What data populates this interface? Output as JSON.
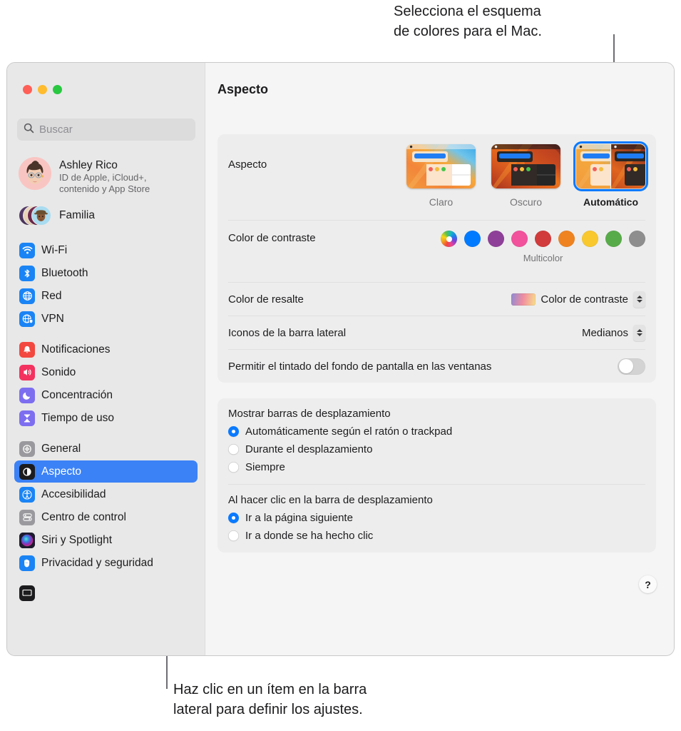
{
  "callouts": {
    "top": "Selecciona el esquema\nde colores para el Mac.",
    "bottom": "Haz clic en un ítem en la barra\nlateral para definir los ajustes."
  },
  "window": {
    "traffic_lights": [
      "close",
      "minimize",
      "zoom"
    ],
    "accent_color": "#3b82f6"
  },
  "search": {
    "placeholder": "Buscar",
    "value": "",
    "icon": "search-icon"
  },
  "sidebar": {
    "account": {
      "name": "Ashley Rico",
      "subtitle": "ID de Apple, iCloud+,\ncontenido y App Store"
    },
    "family": {
      "label": "Familia"
    },
    "groups": [
      {
        "items": [
          {
            "label": "Wi-Fi",
            "icon": "wifi-icon",
            "color": "#1a84f5",
            "selected": false
          },
          {
            "label": "Bluetooth",
            "icon": "bluetooth-icon",
            "color": "#1a84f5",
            "selected": false
          },
          {
            "label": "Red",
            "icon": "network-globe-icon",
            "color": "#1a84f5",
            "selected": false
          },
          {
            "label": "VPN",
            "icon": "vpn-globe-icon",
            "color": "#1a84f5",
            "selected": false
          }
        ]
      },
      {
        "items": [
          {
            "label": "Notificaciones",
            "icon": "bell-icon",
            "color": "#f2483f",
            "selected": false
          },
          {
            "label": "Sonido",
            "icon": "speaker-icon",
            "color": "#f3325f",
            "selected": false
          },
          {
            "label": "Concentración",
            "icon": "moon-icon",
            "color": "#7d6ef0",
            "selected": false
          },
          {
            "label": "Tiempo de uso",
            "icon": "hourglass-icon",
            "color": "#7d6ef0",
            "selected": false
          }
        ]
      },
      {
        "items": [
          {
            "label": "General",
            "icon": "gear-icon",
            "color": "#8e8e93",
            "selected": false
          },
          {
            "label": "Aspecto",
            "icon": "appearance-icon",
            "color": "#1c1c1e",
            "selected": true
          },
          {
            "label": "Accesibilidad",
            "icon": "accessibility-icon",
            "color": "#1a84f5",
            "selected": false
          },
          {
            "label": "Centro de control",
            "icon": "control-center-icon",
            "color": "#8e8e93",
            "selected": false
          },
          {
            "label": "Siri y Spotlight",
            "icon": "siri-icon",
            "color": "#2a2a3a",
            "selected": false
          },
          {
            "label": "Privacidad y seguridad",
            "icon": "privacy-hand-icon",
            "color": "#1a84f5",
            "selected": false
          }
        ]
      }
    ]
  },
  "detail": {
    "title": "Aspecto",
    "appearance": {
      "label": "Aspecto",
      "themes": [
        {
          "caption": "Claro",
          "value": "light",
          "selected": false
        },
        {
          "caption": "Oscuro",
          "value": "dark",
          "selected": false
        },
        {
          "caption": "Automático",
          "value": "auto",
          "selected": true
        }
      ]
    },
    "accent": {
      "label": "Color de contraste",
      "selected_label": "Multicolor",
      "swatches": [
        {
          "name": "multicolor",
          "color": "multicolor",
          "selected": true
        },
        {
          "name": "azul",
          "color": "#007aff",
          "selected": false
        },
        {
          "name": "morado",
          "color": "#8e4098",
          "selected": false
        },
        {
          "name": "rosa",
          "color": "#f2519c",
          "selected": false
        },
        {
          "name": "rojo",
          "color": "#d13b3b",
          "selected": false
        },
        {
          "name": "naranja",
          "color": "#ef8320",
          "selected": false
        },
        {
          "name": "amarillo",
          "color": "#f8c82e",
          "selected": false
        },
        {
          "name": "verde",
          "color": "#58ab49",
          "selected": false
        },
        {
          "name": "grafito",
          "color": "#8e8e8e",
          "selected": false
        }
      ]
    },
    "highlight": {
      "label": "Color de resalte",
      "value": "Color de contraste"
    },
    "sidebar_icons": {
      "label": "Iconos de la barra lateral",
      "value": "Medianos"
    },
    "wallpaper_tint": {
      "label": "Permitir el tintado del fondo de pantalla en las ventanas",
      "enabled": false
    },
    "scrollbars": {
      "title": "Mostrar barras de desplazamiento",
      "options": [
        {
          "label": "Automáticamente según el ratón o trackpad",
          "selected": true
        },
        {
          "label": "Durante el desplazamiento",
          "selected": false
        },
        {
          "label": "Siempre",
          "selected": false
        }
      ]
    },
    "scrollbar_click": {
      "title": "Al hacer clic en la barra de desplazamiento",
      "options": [
        {
          "label": "Ir a la página siguiente",
          "selected": true
        },
        {
          "label": "Ir a donde se ha hecho clic",
          "selected": false
        }
      ]
    },
    "help": {
      "label": "?"
    }
  }
}
